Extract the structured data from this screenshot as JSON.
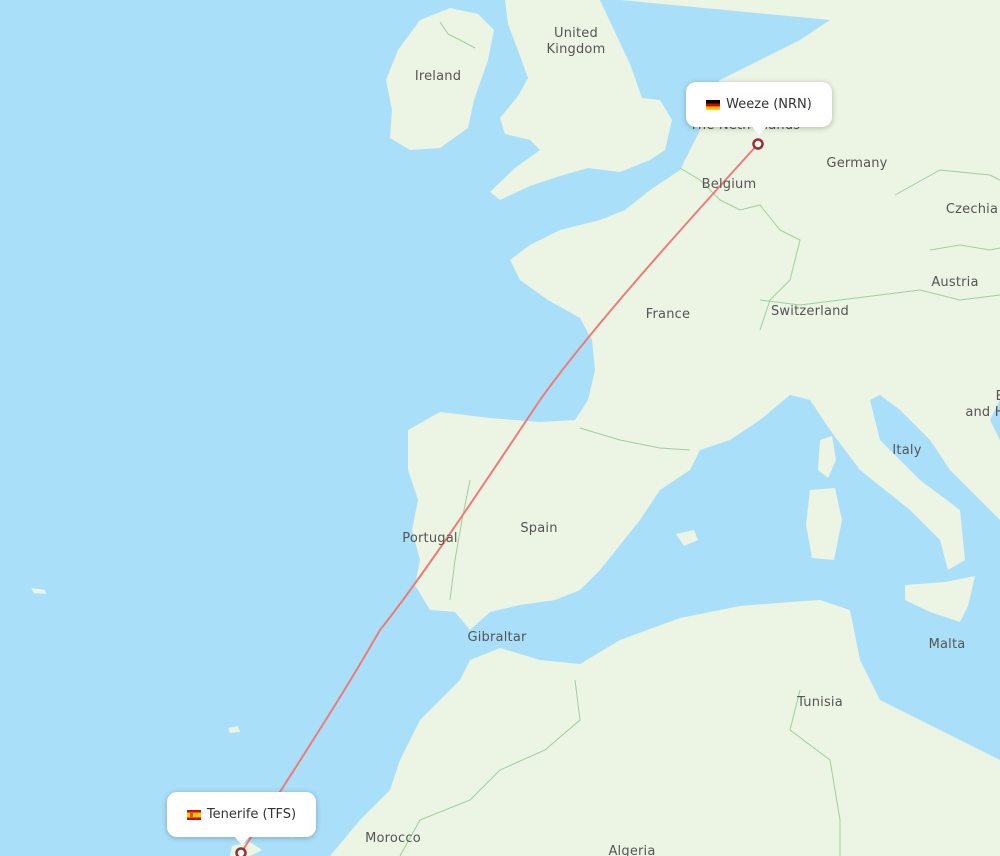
{
  "map": {
    "colors": {
      "water": "#aadff9",
      "land": "#ecf4e3",
      "border": "#9dd09a",
      "route": "#ee7b76",
      "marker": "#9c2e36"
    },
    "country_labels": [
      {
        "id": "ireland",
        "text": "Ireland"
      },
      {
        "id": "uk",
        "text": "United\nKingdom"
      },
      {
        "id": "netherlands",
        "text": "The Netherlands"
      },
      {
        "id": "belgium",
        "text": "Belgium"
      },
      {
        "id": "germany",
        "text": "Germany"
      },
      {
        "id": "czechia",
        "text": "Czechia"
      },
      {
        "id": "austria",
        "text": "Austria"
      },
      {
        "id": "switzerland",
        "text": "Switzerland"
      },
      {
        "id": "france",
        "text": "France"
      },
      {
        "id": "italy",
        "text": "Italy"
      },
      {
        "id": "bosnia",
        "text": "B\nand H"
      },
      {
        "id": "portugal",
        "text": "Portugal"
      },
      {
        "id": "spain",
        "text": "Spain"
      },
      {
        "id": "gibraltar",
        "text": "Gibraltar"
      },
      {
        "id": "malta",
        "text": "Malta"
      },
      {
        "id": "tunisia",
        "text": "Tunisia"
      },
      {
        "id": "morocco",
        "text": "Morocco"
      },
      {
        "id": "algeria",
        "text": "Algeria"
      }
    ],
    "origin": {
      "name": "Weeze (NRN)",
      "country_flag": "germany-flag"
    },
    "destination": {
      "name": "Tenerife (TFS)",
      "country_flag": "spain-flag"
    }
  }
}
